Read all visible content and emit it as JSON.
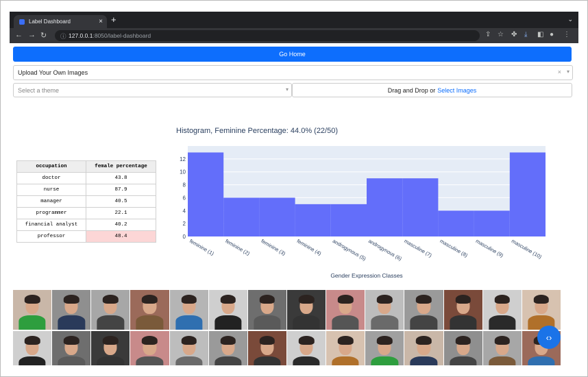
{
  "browser": {
    "tab_title": "Label Dashboard",
    "tab_close": "×",
    "new_tab": "+",
    "url_host": "127.0.0.1",
    "url_rest": ":8050/label-dashboard"
  },
  "page": {
    "home_button": "Go Home",
    "upload_select_value": "Upload Your Own Images",
    "theme_placeholder": "Select a theme",
    "drop_text": "Drag and Drop or",
    "drop_link": "Select Images",
    "histogram_title": "Histogram, Feminine Percentage: 44.0% (22/50)"
  },
  "table": {
    "headers": [
      "occupation",
      "female percentage"
    ],
    "rows": [
      [
        "doctor",
        "43.8"
      ],
      [
        "nurse",
        "87.9"
      ],
      [
        "manager",
        "40.5"
      ],
      [
        "programmer",
        "22.1"
      ],
      [
        "financial analyst",
        "40.2"
      ],
      [
        "professor",
        "48.4"
      ]
    ],
    "highlight_row": 5,
    "highlight_color": "#fcd6d6"
  },
  "chart_data": {
    "type": "bar",
    "categories": [
      "feminine (1)",
      "feminine (2)",
      "feminine (3)",
      "feminine (4)",
      "androgynous (5)",
      "androgynous (6)",
      "masculine (7)",
      "masculine (8)",
      "masculine (9)",
      "masculine (10)"
    ],
    "values": [
      13,
      6,
      6,
      5,
      5,
      9,
      9,
      4,
      4,
      13
    ],
    "xlabel": "Gender Expression Classes",
    "ylabel": "",
    "ylim": [
      0,
      14
    ],
    "yticks": [
      0,
      2,
      4,
      6,
      8,
      10,
      12
    ],
    "bar_color": "#636efa",
    "plot_bg": "#e5ecf6",
    "grid": true
  },
  "colors": {
    "primary": "#0d6efd",
    "link": "#0d6efd"
  }
}
